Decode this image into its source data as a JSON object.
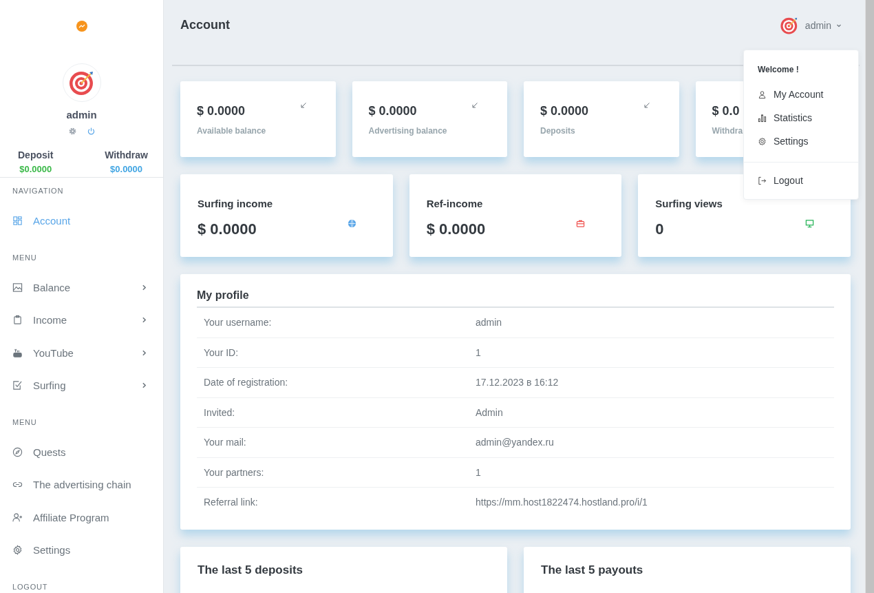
{
  "sidebar": {
    "user": {
      "name": "admin"
    },
    "balances": [
      {
        "label": "Deposit",
        "value": "$0.0000",
        "color": "#3cb94a"
      },
      {
        "label": "Withdraw",
        "value": "$0.0000",
        "color": "#43a6e3"
      }
    ],
    "items": [
      {
        "kind": "section",
        "label": "NAVIGATION"
      },
      {
        "kind": "link",
        "label": "Account",
        "selected": true,
        "submenu": false
      },
      {
        "kind": "section",
        "label": "MENU"
      },
      {
        "kind": "link",
        "label": "Balance",
        "selected": false,
        "submenu": true
      },
      {
        "kind": "link",
        "label": "Income",
        "selected": false,
        "submenu": true
      },
      {
        "kind": "link",
        "label": "YouTube",
        "selected": false,
        "submenu": true
      },
      {
        "kind": "link",
        "label": "Surfing",
        "selected": false,
        "submenu": true
      },
      {
        "kind": "section",
        "label": "MENU"
      },
      {
        "kind": "link",
        "label": "Quests",
        "selected": false,
        "submenu": false
      },
      {
        "kind": "link",
        "label": "The advertising chain",
        "selected": false,
        "submenu": false
      },
      {
        "kind": "link",
        "label": "Affiliate Program",
        "selected": false,
        "submenu": false
      },
      {
        "kind": "link",
        "label": "Settings",
        "selected": false,
        "submenu": false
      },
      {
        "kind": "section",
        "label": "LOGOUT"
      }
    ]
  },
  "header": {
    "title": "Account",
    "user": "admin"
  },
  "balance_cards": [
    {
      "value": "$ 0.0000",
      "label": "Available balance"
    },
    {
      "value": "$ 0.0000",
      "label": "Advertising balance"
    },
    {
      "value": "$ 0.0000",
      "label": "Deposits"
    },
    {
      "value": "$ 0.0",
      "label": "Withdra"
    }
  ],
  "stat_cards": [
    {
      "label": "Surfing income",
      "value": "$ 0.0000",
      "color": "#5aa6e8"
    },
    {
      "label": "Ref-income",
      "value": "$ 0.0000",
      "color": "#ef5350"
    },
    {
      "label": "Surfing views",
      "value": "0",
      "color": "#2bb55b"
    }
  ],
  "profile": {
    "title": "My profile",
    "rows": [
      {
        "label": "Your username:",
        "value": "admin"
      },
      {
        "label": "Your ID:",
        "value": "1"
      },
      {
        "label": "Date of registration:",
        "value": "17.12.2023 в 16:12"
      },
      {
        "label": "Invited:",
        "value": "Admin"
      },
      {
        "label": "Your mail:",
        "value": "admin@yandex.ru"
      },
      {
        "label": "Your partners:",
        "value": "1"
      },
      {
        "label": "Referral link:",
        "value": "https://mm.host1822474.hostland.pro/i/1"
      }
    ]
  },
  "bottom_cards": [
    {
      "title": "The last 5 deposits"
    },
    {
      "title": "The last 5 payouts"
    }
  ],
  "user_menu": {
    "heading": "Welcome !",
    "items": [
      {
        "label": "My Account"
      },
      {
        "label": "Statistics"
      },
      {
        "label": "Settings"
      }
    ],
    "logout": {
      "label": "Logout"
    }
  }
}
